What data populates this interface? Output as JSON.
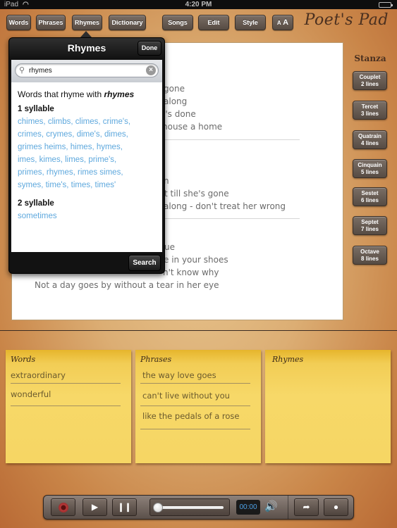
{
  "status_bar": {
    "device": "iPad",
    "time": "4:20 PM"
  },
  "toolbar": {
    "buttons": [
      "Words",
      "Phrases",
      "Rhymes",
      "Dictionary",
      "Songs",
      "Edit",
      "Style"
    ],
    "font_size_small": "A",
    "font_size_large": "A",
    "active": "Rhymes",
    "logo": "Poet's Pad"
  },
  "document": {
    "stanzas": [
      [
        "gone",
        "along",
        "e's done",
        "house a home"
      ],
      [
        "n",
        "t till she's gone",
        "along - don't treat her wrong"
      ],
      [
        "ue",
        "e in your shoes",
        "n't know why",
        "Not a day goes by without a tear in her eye"
      ]
    ]
  },
  "stanza_panel": {
    "title": "Stanza",
    "buttons": [
      {
        "name": "Couplet",
        "lines": "2 lines"
      },
      {
        "name": "Tercet",
        "lines": "3 lines"
      },
      {
        "name": "Quatrain",
        "lines": "4 lines"
      },
      {
        "name": "Cinquain",
        "lines": "5 lines"
      },
      {
        "name": "Sestet",
        "lines": "6 lines"
      },
      {
        "name": "Septet",
        "lines": "7 lines"
      },
      {
        "name": "Octave",
        "lines": "8 lines"
      }
    ]
  },
  "popover": {
    "title": "Rhymes",
    "done_label": "Done",
    "search_value": "rhymes",
    "heading_prefix": "Words that rhyme with ",
    "heading_word": "rhymes",
    "groups": [
      {
        "label": "1 syllable",
        "lines": [
          "chimes,  climbs,  climes,  crime's,",
          "crimes,  crymes,  dime's,  dimes,",
          "grimes heims,  himes,  hymes,",
          "imes,  kimes,  limes,  prime's,",
          "primes,  rhymes,  rimes simes,",
          "symes,  time's,  times,  times'"
        ]
      },
      {
        "label": "2 syllable",
        "lines": [
          "sometimes"
        ]
      }
    ],
    "search_button": "Search",
    "link_color": "#5ea8dd"
  },
  "notes": [
    {
      "title": "Words",
      "items": [
        "extraordinary",
        "wonderful"
      ]
    },
    {
      "title": "Phrases",
      "items": [
        "the way love goes",
        "can't live without you",
        "like the pedals of a rose"
      ]
    },
    {
      "title": "Rhymes",
      "items": []
    }
  ],
  "player": {
    "time": "00:00",
    "progress": 0
  }
}
